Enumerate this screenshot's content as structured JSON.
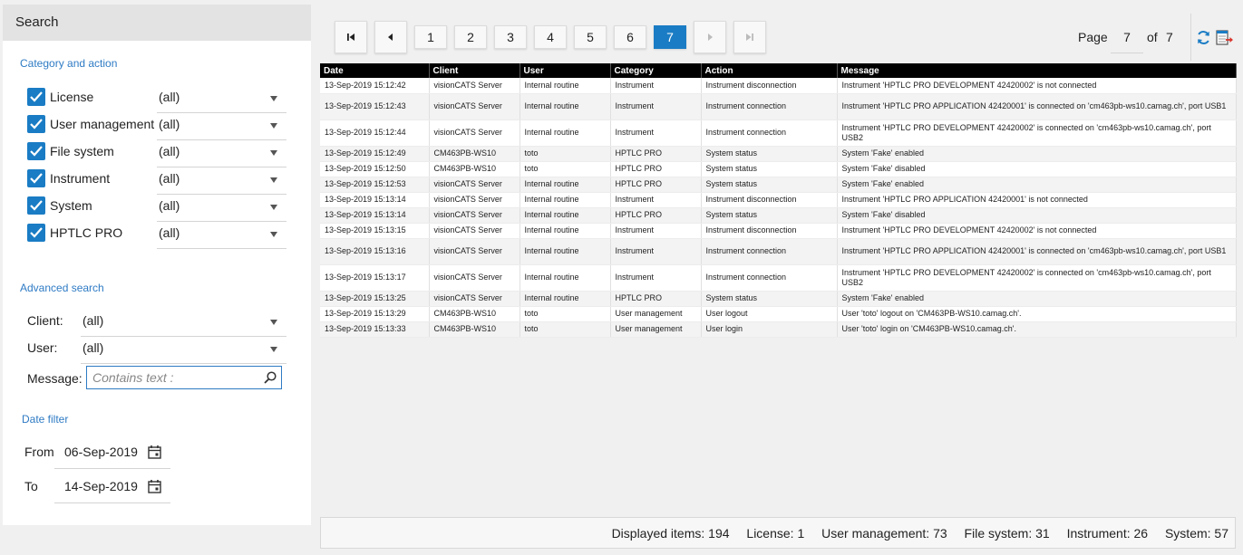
{
  "search_panel": {
    "title": "Search",
    "category_section_title": "Category and action",
    "categories": [
      {
        "label": "License",
        "value": "(all)",
        "checked": true
      },
      {
        "label": "User management",
        "value": "(all)",
        "checked": true
      },
      {
        "label": "File system",
        "value": "(all)",
        "checked": true
      },
      {
        "label": "Instrument",
        "value": "(all)",
        "checked": true
      },
      {
        "label": "System",
        "value": "(all)",
        "checked": true
      },
      {
        "label": "HPTLC PRO",
        "value": "(all)",
        "checked": true
      }
    ],
    "advanced_section_title": "Advanced search",
    "client_label": "Client:",
    "client_value": "(all)",
    "user_label": "User:",
    "user_value": "(all)",
    "message_label": "Message:",
    "message_placeholder": "Contains text :",
    "date_section_title": "Date filter",
    "from_label": "From",
    "from_value": "06-Sep-2019",
    "to_label": "To",
    "to_value": "14-Sep-2019"
  },
  "pagination": {
    "pages": [
      "1",
      "2",
      "3",
      "4",
      "5",
      "6",
      "7"
    ],
    "active_page": "7",
    "page_label": "Page",
    "page_value": "7",
    "of_label": "of",
    "total_pages": "7"
  },
  "table": {
    "columns": [
      "Date",
      "Client",
      "User",
      "Category",
      "Action",
      "Message"
    ],
    "rows": [
      [
        "13-Sep-2019 15:12:42",
        "visionCATS Server",
        "Internal routine",
        "Instrument",
        "Instrument disconnection",
        "Instrument 'HPTLC PRO DEVELOPMENT 42420002' is not connected"
      ],
      [
        "13-Sep-2019 15:12:43",
        "visionCATS Server",
        "Internal routine",
        "Instrument",
        "Instrument connection",
        "Instrument 'HPTLC PRO APPLICATION 42420001' is connected on 'cm463pb-ws10.camag.ch', port USB1"
      ],
      [
        "13-Sep-2019 15:12:44",
        "visionCATS Server",
        "Internal routine",
        "Instrument",
        "Instrument connection",
        "Instrument 'HPTLC PRO DEVELOPMENT 42420002' is connected on 'cm463pb-ws10.camag.ch', port USB2"
      ],
      [
        "13-Sep-2019 15:12:49",
        "CM463PB-WS10",
        "toto",
        "HPTLC PRO",
        "System status",
        "System 'Fake' enabled"
      ],
      [
        "13-Sep-2019 15:12:50",
        "CM463PB-WS10",
        "toto",
        "HPTLC PRO",
        "System status",
        "System 'Fake' disabled"
      ],
      [
        "13-Sep-2019 15:12:53",
        "visionCATS Server",
        "Internal routine",
        "HPTLC PRO",
        "System status",
        "System 'Fake' enabled"
      ],
      [
        "13-Sep-2019 15:13:14",
        "visionCATS Server",
        "Internal routine",
        "Instrument",
        "Instrument disconnection",
        "Instrument 'HPTLC PRO APPLICATION 42420001' is not connected"
      ],
      [
        "13-Sep-2019 15:13:14",
        "visionCATS Server",
        "Internal routine",
        "HPTLC PRO",
        "System status",
        "System 'Fake' disabled"
      ],
      [
        "13-Sep-2019 15:13:15",
        "visionCATS Server",
        "Internal routine",
        "Instrument",
        "Instrument disconnection",
        "Instrument 'HPTLC PRO DEVELOPMENT 42420002' is not connected"
      ],
      [
        "13-Sep-2019 15:13:16",
        "visionCATS Server",
        "Internal routine",
        "Instrument",
        "Instrument connection",
        "Instrument 'HPTLC PRO APPLICATION 42420001' is connected on 'cm463pb-ws10.camag.ch', port USB1"
      ],
      [
        "13-Sep-2019 15:13:17",
        "visionCATS Server",
        "Internal routine",
        "Instrument",
        "Instrument connection",
        "Instrument 'HPTLC PRO DEVELOPMENT 42420002' is connected on 'cm463pb-ws10.camag.ch', port USB2"
      ],
      [
        "13-Sep-2019 15:13:25",
        "visionCATS Server",
        "Internal routine",
        "HPTLC PRO",
        "System status",
        "System 'Fake' enabled"
      ],
      [
        "13-Sep-2019 15:13:29",
        "CM463PB-WS10",
        "toto",
        "User management",
        "User logout",
        "User 'toto' logout on 'CM463PB-WS10.camag.ch'."
      ],
      [
        "13-Sep-2019 15:13:33",
        "CM463PB-WS10",
        "toto",
        "User management",
        "User login",
        "User 'toto' login on 'CM463PB-WS10.camag.ch'."
      ]
    ]
  },
  "status_bar": {
    "displayed_items": "Displayed items: 194",
    "license": "License: 1",
    "user_management": "User management: 73",
    "file_system": "File system: 31",
    "instrument": "Instrument: 26",
    "system": "System: 57"
  },
  "colors": {
    "accent": "#1a7cc4",
    "section_title": "#2e7bc4",
    "table_header_bg": "#000000"
  },
  "icons": {
    "first_page": "first-page-icon",
    "prev_page": "prev-page-icon",
    "next_page": "next-page-icon",
    "last_page": "last-page-icon",
    "refresh": "refresh-icon",
    "export": "export-icon",
    "search": "search-icon",
    "calendar": "calendar-icon"
  }
}
